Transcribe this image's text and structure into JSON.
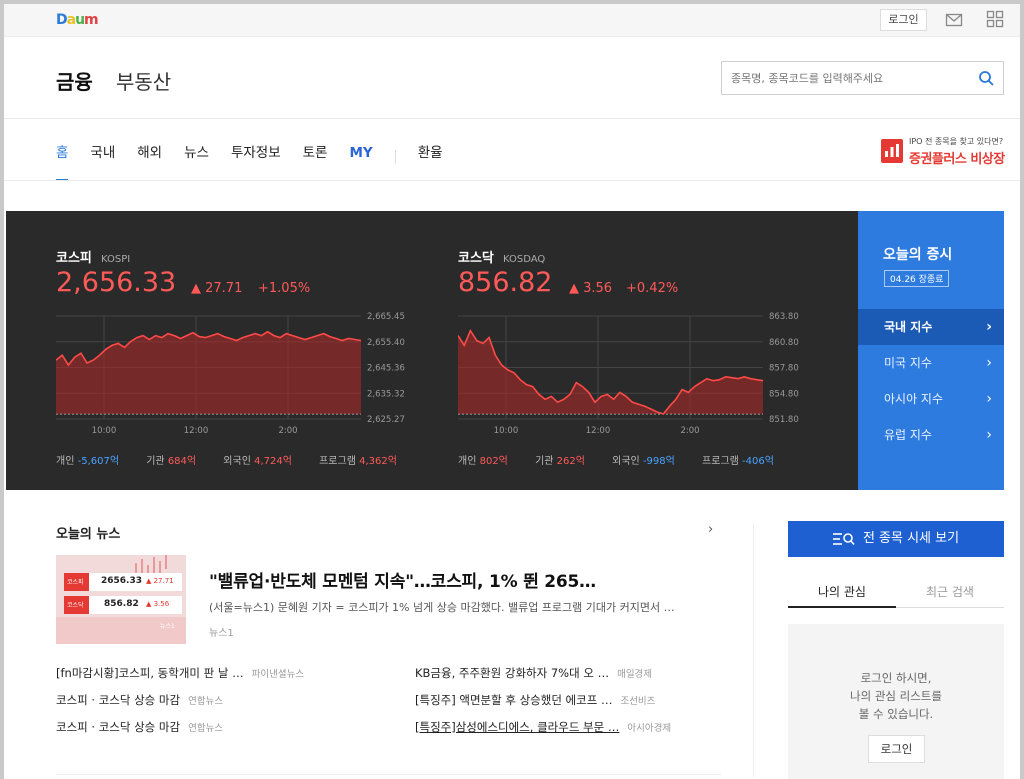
{
  "topbar": {
    "logo": "Daum",
    "login_label": "로그인"
  },
  "header": {
    "tab_finance": "금융",
    "tab_realestate": "부동산",
    "search_placeholder": "종목명, 종목코드를 입력해주세요"
  },
  "nav": {
    "items": [
      "홈",
      "국내",
      "해외",
      "뉴스",
      "투자정보",
      "토론",
      "MY",
      "환율"
    ],
    "active": "홈"
  },
  "promo": {
    "tagline": "IPO 전 종목을 찾고 있다면?",
    "title": "증권플러스 비상장",
    "badge": "비상장"
  },
  "market": {
    "kospi": {
      "name": "코스피",
      "code": "KOSPI",
      "value": "2,656.33",
      "change": "▲ 27.71",
      "percent": "+1.05%",
      "y_ticks": [
        "2,665.45",
        "2,655.40",
        "2,645.36",
        "2,635.32",
        "2,625.27"
      ],
      "x_ticks": [
        "10:00",
        "12:00",
        "2:00"
      ],
      "investors": [
        {
          "label": "개인",
          "value": "-5,607억",
          "sign": "neg"
        },
        {
          "label": "기관",
          "value": "684억",
          "sign": "pos"
        },
        {
          "label": "외국인",
          "value": "4,724억",
          "sign": "pos"
        },
        {
          "label": "프로그램",
          "value": "4,362억",
          "sign": "pos"
        }
      ]
    },
    "kosdaq": {
      "name": "코스닥",
      "code": "KOSDAQ",
      "value": "856.82",
      "change": "▲ 3.56",
      "percent": "+0.42%",
      "y_ticks": [
        "863.80",
        "860.80",
        "857.80",
        "854.80",
        "851.80"
      ],
      "x_ticks": [
        "10:00",
        "12:00",
        "2:00"
      ],
      "investors": [
        {
          "label": "개인",
          "value": "802억",
          "sign": "pos"
        },
        {
          "label": "기관",
          "value": "262억",
          "sign": "pos"
        },
        {
          "label": "외국인",
          "value": "-998억",
          "sign": "neg"
        },
        {
          "label": "프로그램",
          "value": "-406억",
          "sign": "neg"
        }
      ]
    }
  },
  "today": {
    "title": "오늘의 증시",
    "date": "04.26 장종료",
    "items": [
      "국내 지수",
      "미국 지수",
      "아시아 지수",
      "유럽 지수"
    ],
    "chevron": "›"
  },
  "news": {
    "section_title": "오늘의 뉴스",
    "chevron": "›",
    "headline": "\"밸류업·반도체 모멘텀 지속\"…코스피, 1% 뛴 265…",
    "summary": "(서울=뉴스1) 문혜원 기자 = 코스피가 1% 넘게 상승 마감했다. 밸류업 프로그램 기대가 커지면서 …",
    "source": "뉴스1",
    "thumb": {
      "kospi_label": "코스피",
      "kospi_value": "2656.33",
      "kospi_change": "▲ 27.71",
      "kosdaq_label": "코스닥",
      "kosdaq_value": "856.82",
      "kosdaq_change": "▲ 3.56",
      "mark": "뉴스1"
    },
    "left_items": [
      {
        "title": "[fn마감시황]코스피, 동학개미 판 날 …",
        "source": "파이낸셜뉴스"
      },
      {
        "title": "코스피 · 코스닥 상승 마감",
        "source": "연합뉴스"
      },
      {
        "title": "코스피 · 코스닥 상승 마감",
        "source": "연합뉴스"
      }
    ],
    "right_items": [
      {
        "title": "KB금융, 주주환원 강화하자 7%대 오 …",
        "source": "매일경제"
      },
      {
        "title": "[특징주] 액면분할 후 상승했던 에코프 …",
        "source": "조선비즈"
      },
      {
        "title": "[특징주]삼성에스디에스, 클라우드 부문 …",
        "source": "아시아경제"
      }
    ]
  },
  "right_panel": {
    "quote_button": "전 종목 시세 보기",
    "tab_mine": "나의 관심",
    "tab_recent": "최근 검색",
    "login_message": [
      "로그인 하시면,",
      "나의 관심 리스트를",
      "볼 수 있습니다."
    ],
    "login_button": "로그인"
  },
  "colors": {
    "up": "#ff5a57",
    "down": "#4aa3ff",
    "brand_blue": "#2e7be0",
    "dark_panel": "#2a2a2b"
  }
}
